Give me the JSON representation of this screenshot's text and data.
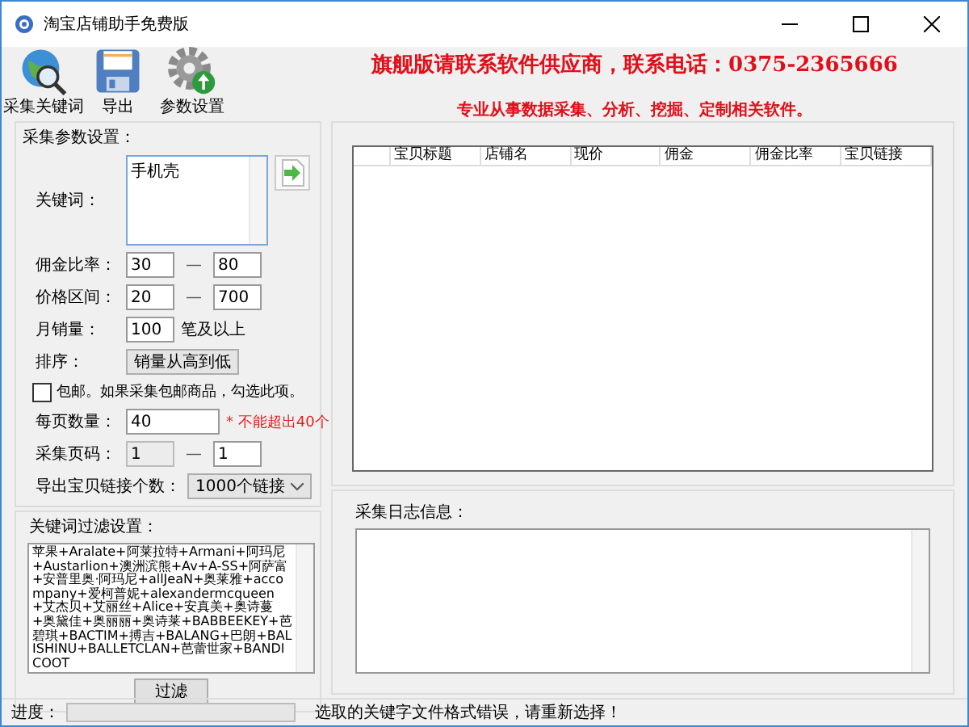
{
  "window": {
    "title": "淘宝店铺助手免费版"
  },
  "toolbar": [
    {
      "kind": "globe",
      "label": "采集关键词"
    },
    {
      "kind": "disk",
      "label": "导出"
    },
    {
      "kind": "gear",
      "label": "参数设置"
    }
  ],
  "banner": {
    "headline": "旗舰版请联系软件供应商，联系电话：0375-2365666",
    "tagline": "专业从事数据采集、分析、挖掘、定制相关软件。"
  },
  "params": {
    "title": "采集参数设置：",
    "keyword": {
      "label": "关键词：",
      "value": "手机壳"
    },
    "commission_rate": {
      "label": "佣金比率：",
      "from": "30",
      "to": "80",
      "dash": "—"
    },
    "price_range": {
      "label": "价格区间：",
      "from": "20",
      "to": "700",
      "dash": "—"
    },
    "monthly_sales": {
      "label": "月销量：",
      "value": "100",
      "suffix": "笔及以上"
    },
    "sort": {
      "label": "排序：",
      "value": "销量从高到低"
    },
    "free_shipping": {
      "label": "包邮。如果采集包邮商品，勾选此项。",
      "checked": false
    },
    "per_page": {
      "label": "每页数量：",
      "value": "40",
      "note": "* 不能超出40个"
    },
    "pages": {
      "label": "采集页码：",
      "from": "1",
      "from_disabled": true,
      "to": "1",
      "dash": "—"
    },
    "export_count": {
      "label": "导出宝贝链接个数：",
      "value": "1000个链接"
    }
  },
  "filter": {
    "title": "关键词过滤设置：",
    "text": "苹果+Aralate+阿莱拉特+Armani+阿玛尼+Austarlion+澳洲滨熊+Av+A-SS+阿萨富+安普里奥·阿玛尼+allJeaN+奥莱雅+accompany+爱柯普妮+alexandermcqueen+艾杰贝+艾丽丝+Alice+安真美+奥诗蔓+奥黛佳+奥丽丽+奥诗莱+BABBEEKEY+芭碧琪+BACTIM+搏吉+BALANG+巴朗+BALISHINU+BALLETCLAN+芭蕾世家+BANDICOOT",
    "button": "过滤"
  },
  "table": {
    "columns": [
      "宝贝标题",
      "店铺名",
      "现价",
      "佣金",
      "佣金比率",
      "宝贝链接"
    ]
  },
  "log": {
    "title": "采集日志信息："
  },
  "status_bar": {
    "label": "进度：",
    "level": 0,
    "message": "选取的关键字文件格式错误，请重新选择！"
  }
}
